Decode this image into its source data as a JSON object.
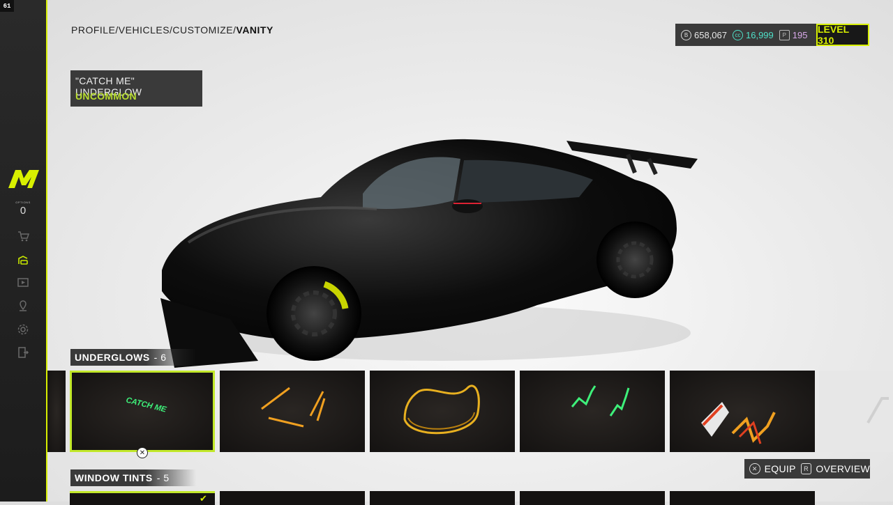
{
  "fps": "61",
  "sidebar": {
    "options_label": "OPTIONS",
    "options_count": "0",
    "icons": [
      "cart-icon",
      "garage-icon",
      "play-icon",
      "map-pin-icon",
      "gear-icon",
      "exit-icon"
    ],
    "accent": "#d8f000"
  },
  "breadcrumb": {
    "path": "PROFILE/VEHICLES/CUSTOMIZE/",
    "current": "VANITY"
  },
  "currencies": {
    "bucks": "658,067",
    "cc": "16,999",
    "parts": "195",
    "level": "LEVEL 310"
  },
  "item": {
    "title": "\"CATCH ME\" UNDERGLOW",
    "rarity": "UNCOMMON",
    "rarity_color": "#b8dd2e"
  },
  "sections": [
    {
      "label": "UNDERGLOWS",
      "count": "- 6"
    },
    {
      "label": "WINDOW TINTS",
      "count": "- 5"
    }
  ],
  "underglow_tiles": [
    {
      "name": "catch-me-underglow",
      "text": "CATCH ME",
      "selected": true
    },
    {
      "name": "orange-slash-underglow"
    },
    {
      "name": "gold-ring-underglow"
    },
    {
      "name": "green-scribble-underglow"
    },
    {
      "name": "stripe-underglow"
    }
  ],
  "hints": {
    "equip": "EQUIP",
    "overview": "OVERVIEW"
  }
}
